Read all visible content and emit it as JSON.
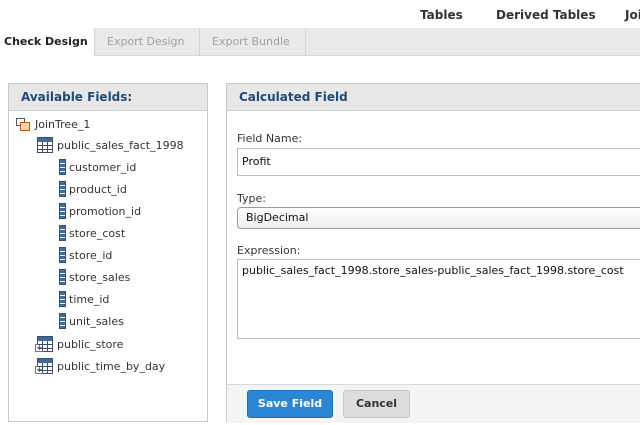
{
  "topnav": {
    "tables": "Tables",
    "derived": "Derived Tables",
    "join": "Join"
  },
  "tabs": [
    {
      "label": "Check Design"
    },
    {
      "label": "Export Design"
    },
    {
      "label": "Export Bundle"
    }
  ],
  "left_panel": {
    "title": "Available Fields:",
    "tree": {
      "root": "JoinTree_1",
      "table1": "public_sales_fact_1998",
      "columns": [
        "customer_id",
        "product_id",
        "promotion_id",
        "store_cost",
        "store_id",
        "store_sales",
        "time_id",
        "unit_sales"
      ],
      "table2": "public_store",
      "table3": "public_time_by_day"
    }
  },
  "right_panel": {
    "title": "Calculated Field",
    "field_name_label": "Field Name:",
    "field_name_value": "Profit",
    "type_label": "Type:",
    "type_value": "BigDecimal",
    "expression_label": "Expression:",
    "expression_value": "public_sales_fact_1998.store_sales-public_sales_fact_1998.store_cost",
    "save_label": "Save Field",
    "cancel_label": "Cancel"
  },
  "colors": {
    "accent": "#2b86d6",
    "header_text": "#1f4a7a"
  }
}
